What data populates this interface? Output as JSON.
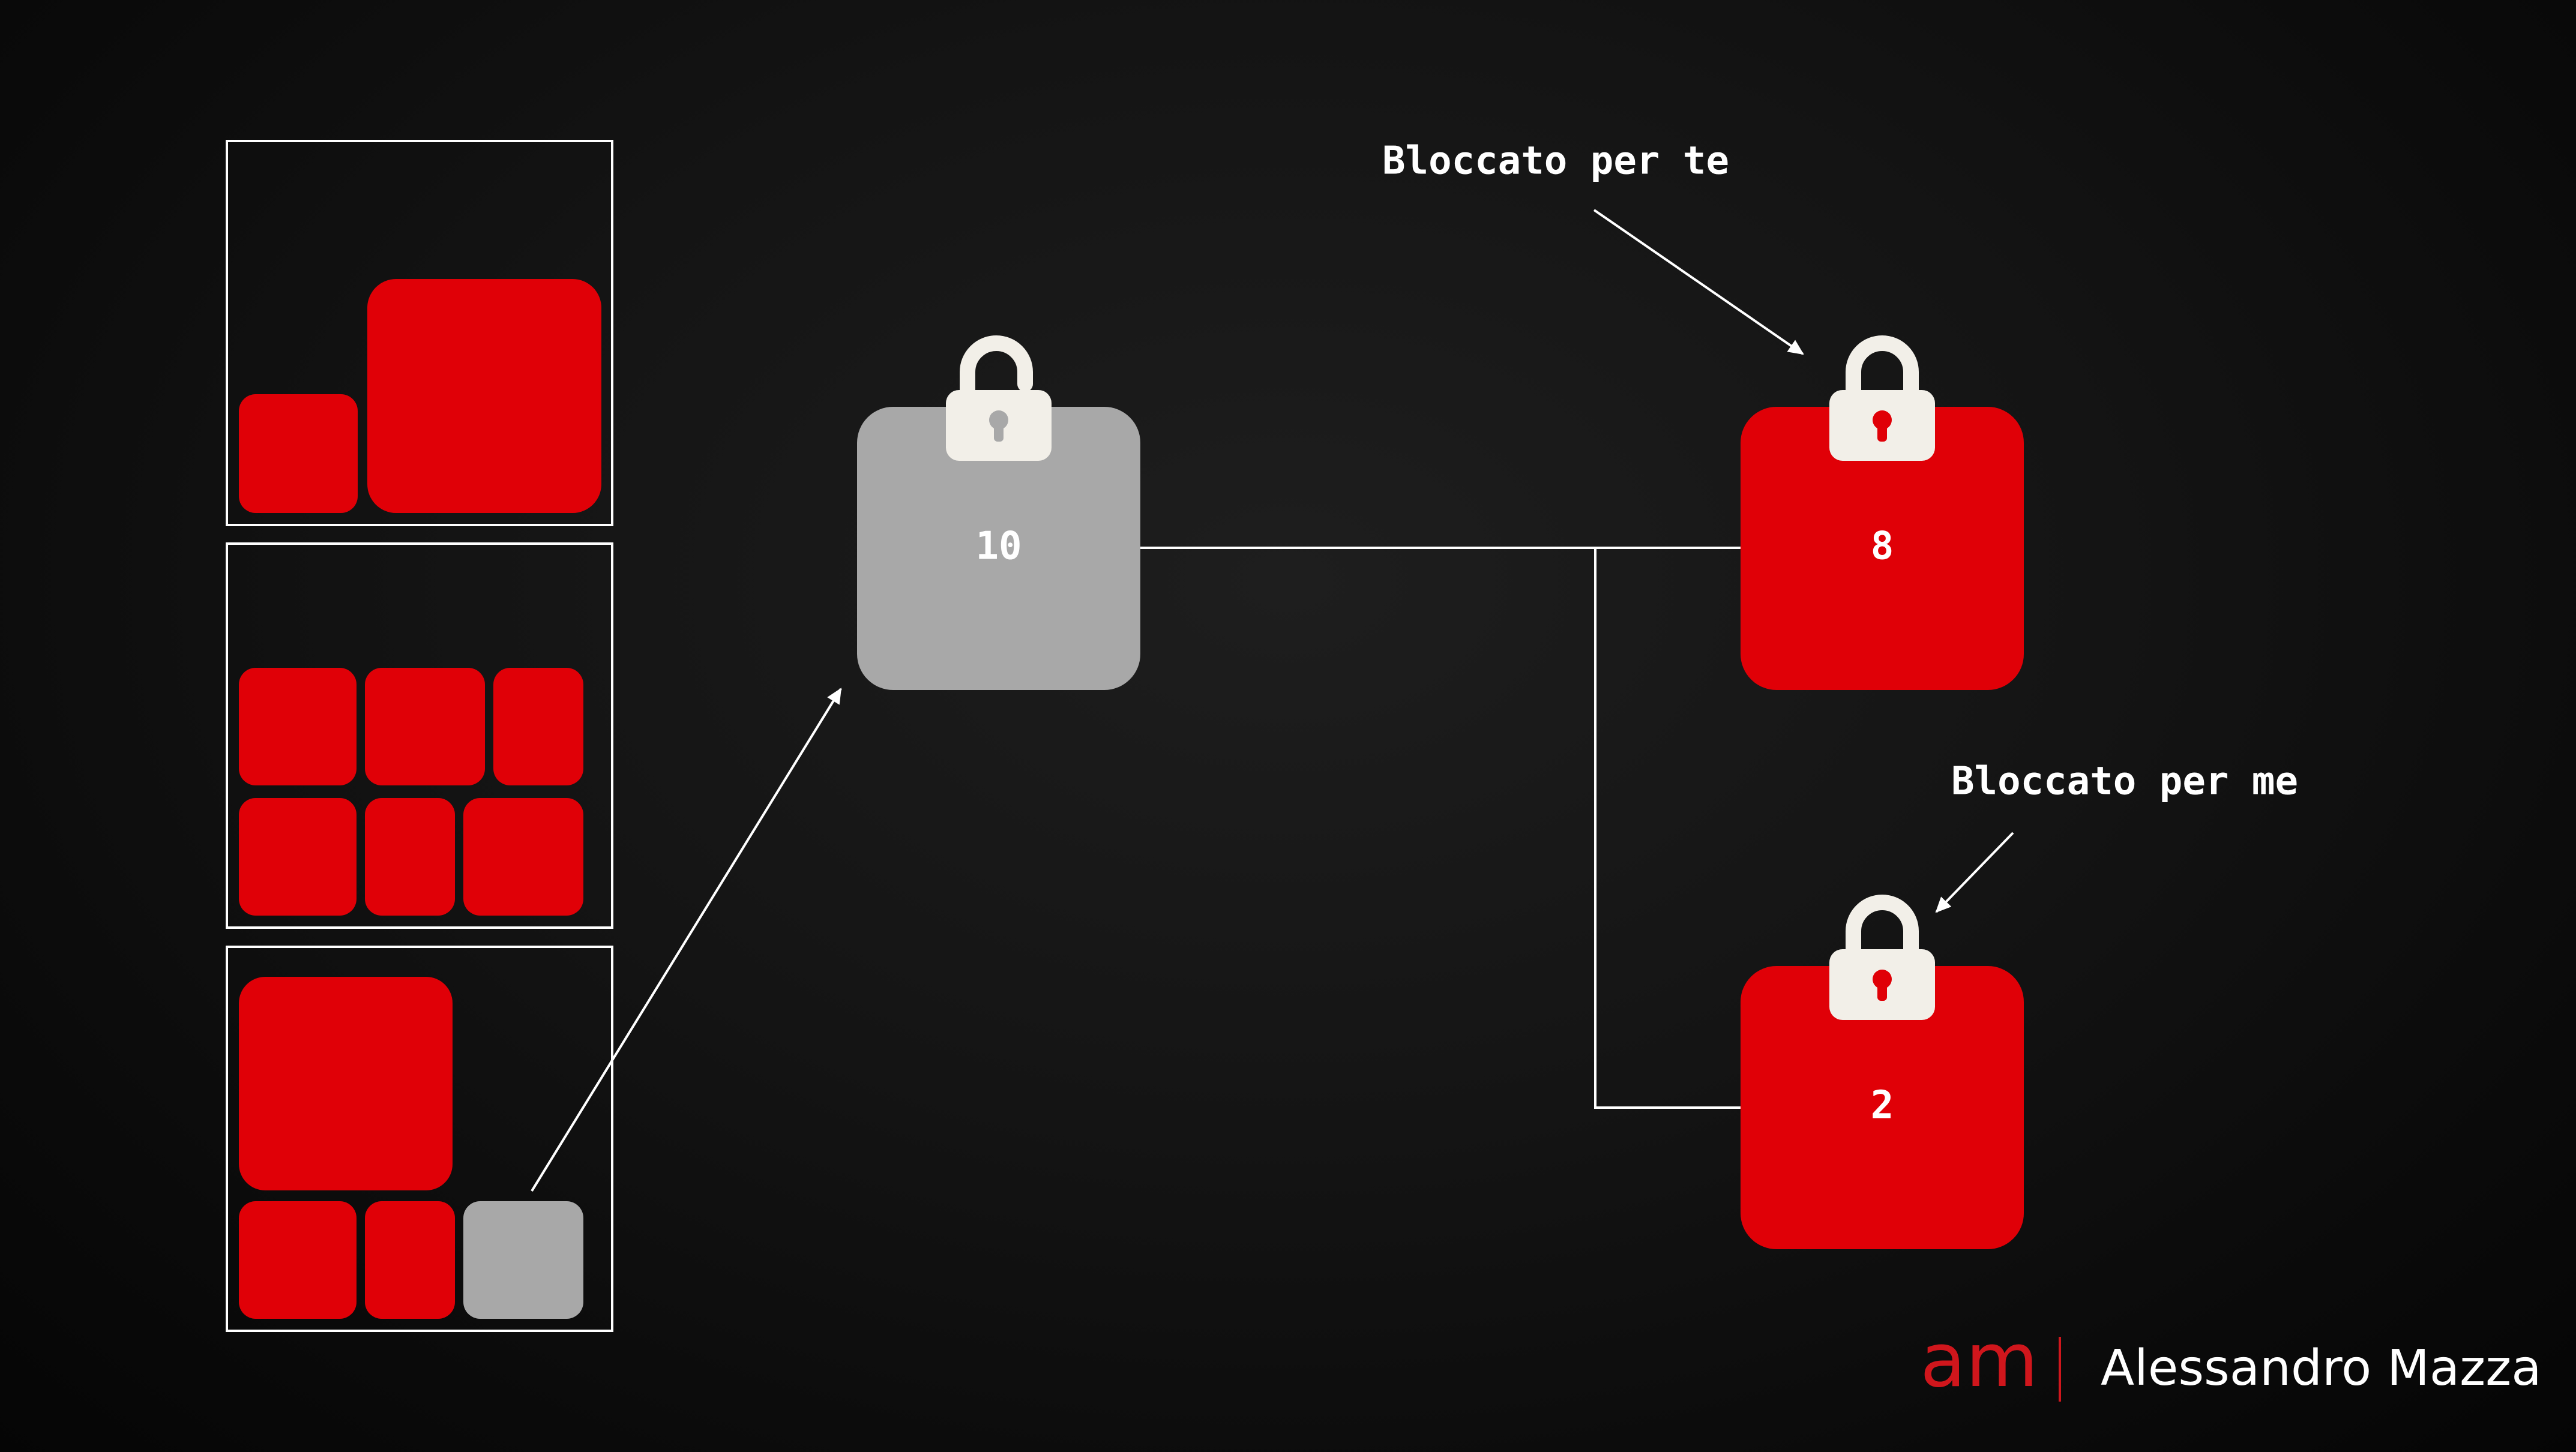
{
  "colors": {
    "background": "#0b0b0b",
    "block_red": "#e00007",
    "block_gray": "#a8a8a8",
    "lock": "#f2efe8",
    "lines": "#ffffff",
    "brand_red": "#d0161c",
    "brand_text": "#ffffff"
  },
  "nodes": {
    "free": {
      "value": "10",
      "state": "unlocked",
      "icon": "lock-open-icon"
    },
    "locked_for_you": {
      "value": "8",
      "state": "locked",
      "icon": "lock-closed-icon"
    },
    "locked_for_me": {
      "value": "2",
      "state": "locked",
      "icon": "lock-closed-icon"
    }
  },
  "annotations": {
    "locked_for_you": "Bloccato per te",
    "locked_for_me": "Bloccato per me"
  },
  "utxo_panels": [
    {
      "blocks": [
        "red",
        "red"
      ]
    },
    {
      "blocks": [
        "red",
        "red",
        "red",
        "red",
        "red",
        "red"
      ]
    },
    {
      "blocks": [
        "red",
        "red",
        "red",
        "gray"
      ]
    }
  ],
  "brand": {
    "logo_letters": "am",
    "name": "Alessandro Mazza"
  }
}
